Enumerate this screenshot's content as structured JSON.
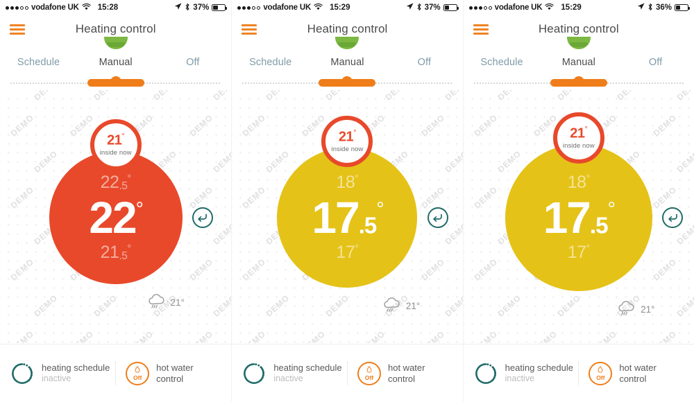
{
  "app": {
    "title": "Heating control",
    "menu_icon": "hamburger-icon"
  },
  "tabs": [
    {
      "label": "Schedule",
      "active": false
    },
    {
      "label": "Manual",
      "active": true
    },
    {
      "label": "Off",
      "active": false
    }
  ],
  "colors": {
    "orange_accent": "#ef7d1a",
    "dial_red": "#e8492b",
    "dial_yellow": "#e5c217",
    "teal": "#1f6b68",
    "green_arc": "#7cb842",
    "tab_inactive": "#7f9ba8",
    "tab_active": "#4c4c4c"
  },
  "footer": {
    "schedule": {
      "title": "heating schedule",
      "status": "inactive",
      "icon": "schedule-ring-icon"
    },
    "hot_water": {
      "title_line1": "hot water",
      "title_line2": "control",
      "state": "Off",
      "icon": "water-drop-icon"
    }
  },
  "weather": {
    "icon": "cloud-rain-icon",
    "temperature": "21°"
  },
  "badge": {
    "temperature": "21",
    "degree": "°",
    "label": "inside now"
  },
  "refresh": {
    "icon": "return-arrow-icon"
  },
  "watermark": {
    "text": "DEMO"
  },
  "panels": [
    {
      "status": {
        "signal_filled": 3,
        "signal_empty": 2,
        "carrier": "vodafone UK",
        "wifi_icon": "wifi-icon",
        "time": "15:28",
        "location_icon": "location-arrow-icon",
        "bluetooth_icon": "bluetooth-icon",
        "battery_percent": "37%",
        "battery_level": 37
      },
      "dial": {
        "color": "#e8492b",
        "size": 192,
        "target_above": {
          "int": "22",
          "frac": ".5",
          "deg": "°"
        },
        "target_main": {
          "int": "22",
          "frac": "",
          "deg": "°"
        },
        "target_below": {
          "int": "21",
          "frac": ".5",
          "deg": "°"
        }
      }
    },
    {
      "status": {
        "signal_filled": 3,
        "signal_empty": 2,
        "carrier": "vodafone UK",
        "wifi_icon": "wifi-icon",
        "time": "15:29",
        "location_icon": "location-arrow-icon",
        "bluetooth_icon": "bluetooth-icon",
        "battery_percent": "37%",
        "battery_level": 37
      },
      "dial": {
        "color": "#e5c217",
        "size": 202,
        "target_above": {
          "int": "18",
          "frac": "",
          "deg": "°"
        },
        "target_main": {
          "int": "17",
          "frac": ".5",
          "deg": "°"
        },
        "target_below": {
          "int": "17",
          "frac": "",
          "deg": "°"
        }
      }
    },
    {
      "status": {
        "signal_filled": 3,
        "signal_empty": 2,
        "carrier": "vodafone UK",
        "wifi_icon": "wifi-icon",
        "time": "15:29",
        "location_icon": "location-arrow-icon",
        "bluetooth_icon": "bluetooth-icon",
        "battery_percent": "36%",
        "battery_level": 36
      },
      "dial": {
        "color": "#e5c217",
        "size": 212,
        "target_above": {
          "int": "18",
          "frac": "",
          "deg": "°"
        },
        "target_main": {
          "int": "17",
          "frac": ".5",
          "deg": "°"
        },
        "target_below": {
          "int": "17",
          "frac": "",
          "deg": "°"
        }
      }
    }
  ]
}
